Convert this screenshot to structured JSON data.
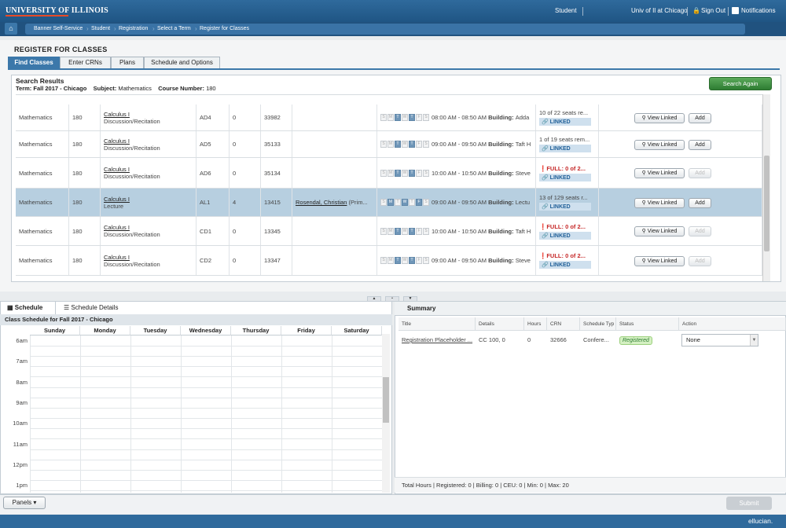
{
  "header": {
    "logo": "UNIVERSITY OF ILLINOIS",
    "links": [
      "Student",
      "Univ of Il at Chicago",
      "Sign Out",
      "Notifications"
    ]
  },
  "breadcrumbs": [
    "Banner Self-Service",
    "Student",
    "Registration",
    "Select a Term",
    "Register for Classes"
  ],
  "page_title": "REGISTER FOR CLASSES",
  "tabs": [
    "Find Classes",
    "Enter CRNs",
    "Plans",
    "Schedule and Options"
  ],
  "search": {
    "title": "Search Results",
    "term_label": "Term:",
    "term": "Fall 2017 - Chicago",
    "subject_label": "Subject:",
    "subject": "Mathematics",
    "course_label": "Course Number:",
    "course": "180",
    "again_button": "Search Again"
  },
  "day_letters": [
    "S",
    "M",
    "T",
    "W",
    "T",
    "F",
    "S"
  ],
  "rows": [
    {
      "subject": "Mathematics",
      "course": "180",
      "title": "Calculus I",
      "type": "Discussion/Recitation",
      "section": "AD4",
      "hours": "0",
      "crn": "33982",
      "instructor": "",
      "instructor_suffix": "",
      "days": [
        0,
        0,
        1,
        0,
        1,
        0,
        0
      ],
      "time": "08:00 AM - 08:50 AM",
      "building_label": "Building:",
      "building": "Adda",
      "status": "10 of 22 seats re...",
      "status_full": false,
      "linked": "LINKED",
      "add_enabled": true
    },
    {
      "subject": "Mathematics",
      "course": "180",
      "title": "Calculus I",
      "type": "Discussion/Recitation",
      "section": "AD5",
      "hours": "0",
      "crn": "35133",
      "instructor": "",
      "instructor_suffix": "",
      "days": [
        0,
        0,
        1,
        0,
        1,
        0,
        0
      ],
      "time": "09:00 AM - 09:50 AM",
      "building_label": "Building:",
      "building": "Taft H",
      "status": "1 of 19 seats rem...",
      "status_full": false,
      "linked": "LINKED",
      "add_enabled": true
    },
    {
      "subject": "Mathematics",
      "course": "180",
      "title": "Calculus I",
      "type": "Discussion/Recitation",
      "section": "AD6",
      "hours": "0",
      "crn": "35134",
      "instructor": "",
      "instructor_suffix": "",
      "days": [
        0,
        0,
        1,
        0,
        1,
        0,
        0
      ],
      "time": "10:00 AM - 10:50 AM",
      "building_label": "Building:",
      "building": "Steve",
      "status": "FULL: 0 of 2...",
      "status_full": true,
      "linked": "LINKED",
      "add_enabled": false
    },
    {
      "subject": "Mathematics",
      "course": "180",
      "title": "Calculus I",
      "type": "Lecture",
      "section": "AL1",
      "hours": "4",
      "crn": "13415",
      "instructor": "Rosendal, Christian",
      "instructor_suffix": "(Prim...",
      "days": [
        0,
        1,
        0,
        1,
        0,
        1,
        0
      ],
      "time": "09:00 AM - 09:50 AM",
      "building_label": "Building:",
      "building": "Lectu",
      "status": "13 of 129 seats r...",
      "status_full": false,
      "linked": "LINKED",
      "add_enabled": true
    },
    {
      "subject": "Mathematics",
      "course": "180",
      "title": "Calculus I",
      "type": "Discussion/Recitation",
      "section": "CD1",
      "hours": "0",
      "crn": "13345",
      "instructor": "",
      "instructor_suffix": "",
      "days": [
        0,
        0,
        1,
        0,
        1,
        0,
        0
      ],
      "time": "10:00 AM - 10:50 AM",
      "building_label": "Building:",
      "building": "Taft H",
      "status": "FULL: 0 of 2...",
      "status_full": true,
      "linked": "LINKED",
      "add_enabled": false
    },
    {
      "subject": "Mathematics",
      "course": "180",
      "title": "Calculus I",
      "type": "Discussion/Recitation",
      "section": "CD2",
      "hours": "0",
      "crn": "13347",
      "instructor": "",
      "instructor_suffix": "",
      "days": [
        0,
        0,
        1,
        0,
        1,
        0,
        0
      ],
      "time": "09:00 AM - 09:50 AM",
      "building_label": "Building:",
      "building": "Steve",
      "status": "FULL: 0 of 2...",
      "status_full": true,
      "linked": "LINKED",
      "add_enabled": false
    }
  ],
  "row_buttons": {
    "view": "View Linked",
    "add": "Add"
  },
  "schedule": {
    "tabs": [
      "Schedule",
      "Schedule Details"
    ],
    "title": "Class Schedule for Fall 2017 - Chicago",
    "days": [
      "Sunday",
      "Monday",
      "Tuesday",
      "Wednesday",
      "Thursday",
      "Friday",
      "Saturday"
    ],
    "hours": [
      "6am",
      "7am",
      "8am",
      "9am",
      "10am",
      "11am",
      "12pm",
      "1pm"
    ]
  },
  "summary": {
    "title": "Summary",
    "columns": [
      "Title",
      "Details",
      "Hours",
      "CRN",
      "Schedule Typ",
      "Status",
      "Action"
    ],
    "row": {
      "title": "Registration Placeholder ...",
      "details": "CC 100, 0",
      "hours": "0",
      "crn": "32666",
      "schedule_type": "Confere...",
      "status": "Registered",
      "action": "None"
    },
    "totals": "Total Hours | Registered: 0 | Billing: 0 | CEU: 0 | Min: 0 | Max: 20"
  },
  "footer": {
    "panels": "Panels",
    "submit": "Submit",
    "brand": "ellucian."
  }
}
